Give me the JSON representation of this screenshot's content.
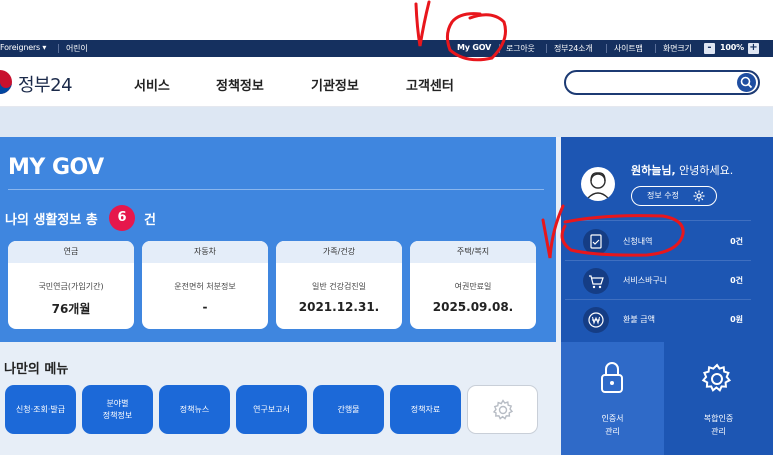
{
  "topbar": {
    "foreigners": "Foreigners",
    "children": "어린이",
    "mygov": "My GOV",
    "logout": "로그아웃",
    "about": "정부24소개",
    "sitemap": "사이트맵",
    "screen_size": "화면크기",
    "zoom_minus": "-",
    "zoom_value": "100%",
    "zoom_plus": "+"
  },
  "header": {
    "logo_text": "정부24",
    "nav": [
      "서비스",
      "정책정보",
      "기관정보",
      "고객센터"
    ],
    "search_placeholder": ""
  },
  "mygov": {
    "title": "MY GOV",
    "info_title": "나의 생활정보 총",
    "info_count": "6",
    "info_unit": "건",
    "cards": [
      {
        "head": "연금",
        "sub": "국민연금(가입기간)",
        "value": "76개월"
      },
      {
        "head": "자동차",
        "sub": "운전면허 처분정보",
        "value": "-"
      },
      {
        "head": "가족/건강",
        "sub": "일반 건강검진일",
        "value": "2021.12.31."
      },
      {
        "head": "주택/복지",
        "sub": "여권만료일",
        "value": "2025.09.08."
      }
    ]
  },
  "my_menu": {
    "title": "나만의 메뉴",
    "items": [
      "신청·조회·발급",
      "분야별\n정책정보",
      "정책뉴스",
      "연구보고서",
      "간행물",
      "정책자료"
    ]
  },
  "side": {
    "greeting_name": "원하늘님,",
    "greeting_rest": " 안녕하세요.",
    "edit_label": "정보 수정",
    "rows": [
      {
        "label": "신청내역",
        "value": "0건",
        "icon": "document-check-icon"
      },
      {
        "label": "서비스바구니",
        "value": "0건",
        "icon": "cart-icon"
      },
      {
        "label": "환불 금액",
        "value": "0원",
        "icon": "won-coin-icon"
      }
    ],
    "cert_label": "인증서\n관리",
    "combined_label": "복합인증\n관리"
  },
  "colors": {
    "topbar": "#15305f",
    "mygov_panel": "#3f86df",
    "side_panel": "#1d56b3",
    "badge": "#e6174c",
    "menu_button": "#1c69d8",
    "annotation": "#e8161c"
  }
}
